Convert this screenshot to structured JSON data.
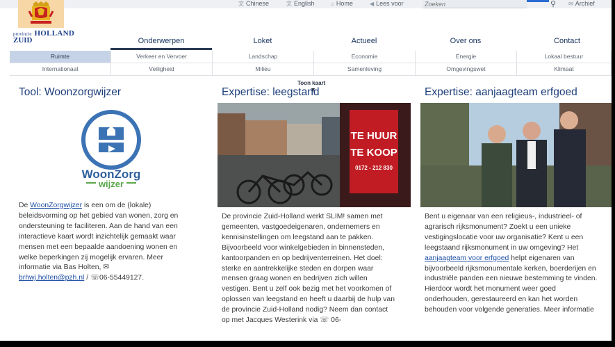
{
  "topbar": {
    "links": [
      {
        "icon": "chinese-language-icon",
        "glyph": "文",
        "label": "Chinese"
      },
      {
        "icon": "english-language-icon",
        "glyph": "文",
        "label": "English"
      },
      {
        "icon": "home-icon",
        "glyph": "⌂",
        "label": "Home"
      },
      {
        "icon": "speaker-icon",
        "glyph": "◀",
        "label": "Lees voor"
      }
    ],
    "search_placeholder": "Zoeken",
    "archive_label": "Archief"
  },
  "brand": {
    "provincie": "provincie",
    "holland": "HOLLAND",
    "zuid": "ZUID"
  },
  "main_nav": [
    {
      "label": "Onderwerpen",
      "active": true
    },
    {
      "label": "Loket",
      "active": false
    },
    {
      "label": "Actueel",
      "active": false
    },
    {
      "label": "Over ons",
      "active": false
    },
    {
      "label": "Contact",
      "active": false
    }
  ],
  "sub_nav": [
    [
      {
        "label": "Ruimte",
        "active": true
      },
      {
        "label": "Verkeer en Vervoer",
        "active": false
      },
      {
        "label": "Landschap",
        "active": false
      },
      {
        "label": "Economie",
        "active": false
      },
      {
        "label": "Energie",
        "active": false
      },
      {
        "label": "Lokaal bestuur",
        "active": false
      }
    ],
    [
      {
        "label": "Internationaal",
        "active": false
      },
      {
        "label": "Veiligheid",
        "active": false
      },
      {
        "label": "Milieu",
        "active": false
      },
      {
        "label": "Samenleving",
        "active": false
      },
      {
        "label": "Omgevingswet",
        "active": false
      },
      {
        "label": "Klimaat",
        "active": false
      }
    ]
  ],
  "toon_kaart": "Toon kaart",
  "columns": {
    "woonzorg": {
      "title": "Tool: Woonzorgwijzer",
      "logo_top": "WoonZorg",
      "logo_bottom": "wijzer",
      "text_intro": "De ",
      "text_link": "WoonZorgwijzer",
      "text_body": " is een om de (lokale) beleidsvorming op het gebied van wonen, zorg en ondersteuning te faciliteren. Aan de hand van een interactieve kaart wordt inzichtelijk gemaakt waar mensen met een bepaalde aandoening wonen en welke beperkingen zij mogelijk ervaren. Meer informatie via Bas Holten, ",
      "email": "brhwj.holten@pzh.nl",
      "phone": " / ☏06-55449127."
    },
    "leegstand": {
      "title": "Expertise: leegstand",
      "photo_sign_1": "TE HUUR",
      "photo_sign_2": "TE KOOP",
      "photo_sign_3": "0172 - 212 830",
      "text": "De provincie Zuid-Holland werkt SLIM! samen met gemeenten, vastgoedeigenaren, ondernemers en kennisinstellingen om leegstand aan te pakken. Bijvoorbeeld voor winkelgebieden in binnensteden, kantoorpanden en op bedrijventerreinen. Het doel: sterke en aantrekkelijke steden en dorpen waar mensen graag wonen en bedrijven zich willen vestigen. Bent u zelf ook bezig met het voorkomen of oplossen van leegstand en heeft u daarbij de hulp van de provincie Zuid-Holland nodig? Neem dan contact op met Jacques Westerink via ☏ 06-"
    },
    "erfgoed": {
      "title": "Expertise: aanjaagteam erfgoed",
      "text_intro": "Bent u eigenaar van een religieus-, industrieel- of agrarisch rijksmonument? Zoekt u een unieke vestigingslocatie voor uw organisatie? Kent u een leegstaand rijksmonument in uw omgeving? Het ",
      "text_link": "aanjaagteam voor erfgoed",
      "text_body": " helpt eigenaren van bijvoorbeeld rijksmonumentale kerken, boerderijen en industriële panden een nieuwe bestemming te vinden. Hierdoor wordt het monument weer goed onderhouden, gerestaureerd en kan het worden behouden voor volgende generaties. Meer informatie"
    }
  },
  "colors": {
    "brand_blue": "#1e3f7a",
    "link_blue": "#1e4fa3",
    "active_tab_bg": "#c6d3e6",
    "logo_bg": "#f7d7a6"
  }
}
